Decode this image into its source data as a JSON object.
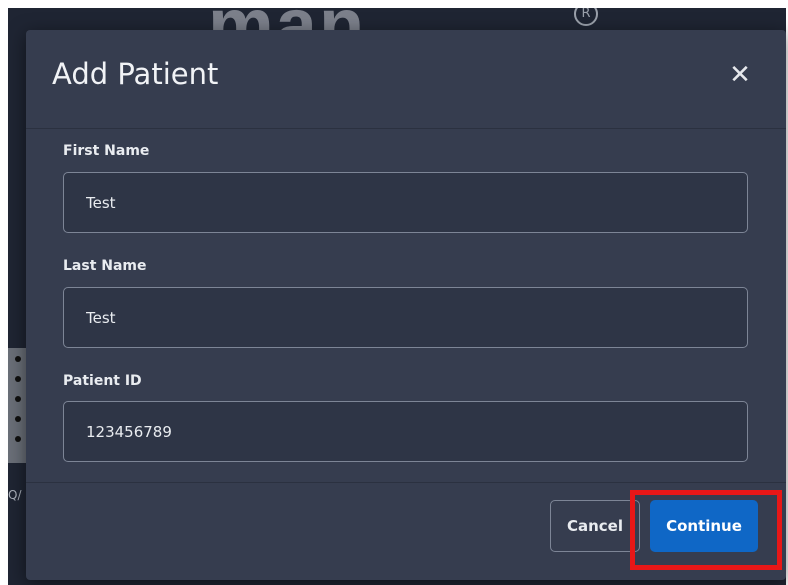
{
  "background": {
    "logo_text_light": "man",
    "logo_text_blue": "…",
    "logo_mark": "R",
    "partial_text": "Q/"
  },
  "modal": {
    "title": "Add Patient",
    "close_icon": "close-icon",
    "fields": [
      {
        "label": "First Name",
        "value": "Test"
      },
      {
        "label": "Last Name",
        "value": "Test"
      },
      {
        "label": "Patient ID",
        "value": "123456789"
      }
    ],
    "cancel_label": "Cancel",
    "continue_label": "Continue"
  },
  "colors": {
    "modal_bg": "#363d4f",
    "primary": "#0f67c6",
    "highlight": "#e81717"
  }
}
